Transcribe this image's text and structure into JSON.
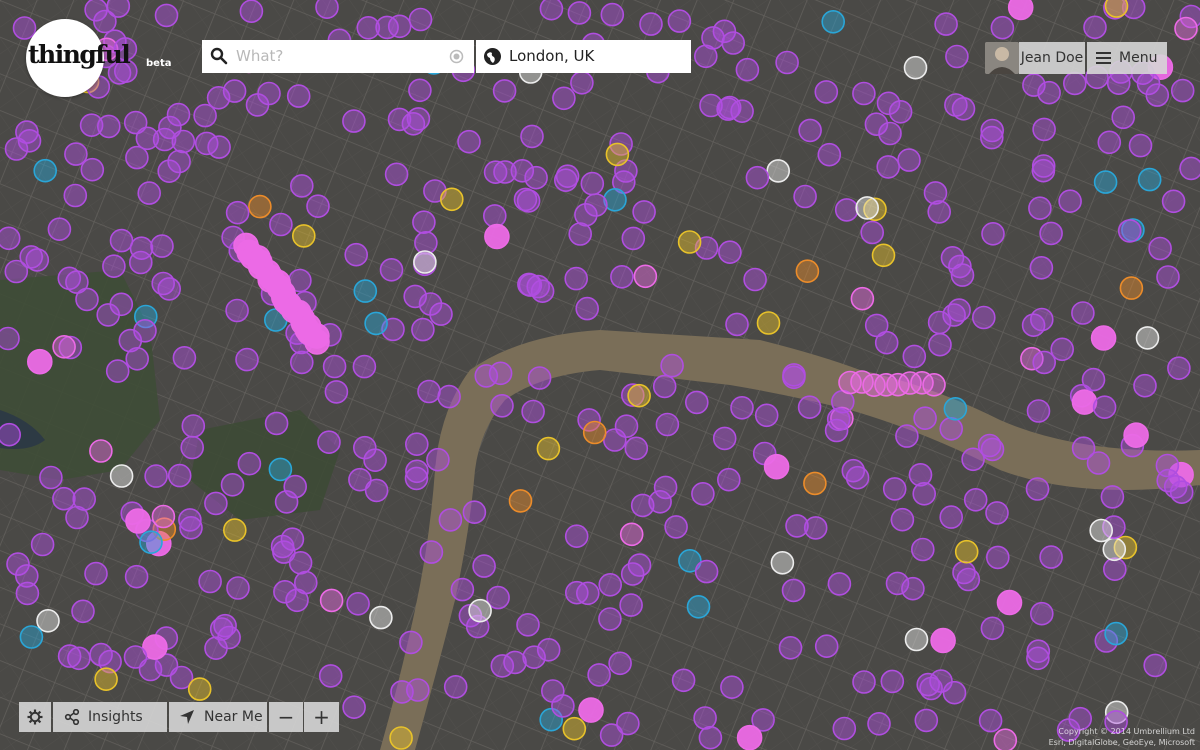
{
  "app": {
    "logo_text": "thingful",
    "logo_tag": "beta"
  },
  "search": {
    "placeholder": "What?",
    "value": "",
    "icon": "search-icon",
    "clear_icon": "clear-target-icon"
  },
  "location": {
    "value": "London, UK",
    "icon": "globe-icon"
  },
  "user": {
    "name": "Jean Doe",
    "avatar": "avatar"
  },
  "menu": {
    "label": "Menu",
    "icon": "hamburger-icon"
  },
  "toolbar": {
    "settings_icon": "gear-icon",
    "insights_label": "Insights",
    "insights_icon": "share-icon",
    "near_me_label": "Near Me",
    "near_me_icon": "location-arrow-icon",
    "zoom_out_label": "−",
    "zoom_in_label": "+"
  },
  "attribution": {
    "line1": "Copyright © 2014 Umbrellium Ltd",
    "line2": "Esri, DigitalGlobe, GeoEye, Microsoft"
  },
  "map": {
    "type": "satellite",
    "city": "London",
    "marker_colors": {
      "purple": "#b04ee0",
      "pink": "#ec6ae6",
      "cyan": "#2aa6d8",
      "yellow": "#e8c22a",
      "orange": "#ec8c2a",
      "white": "#ececec",
      "green": "#8ac23a"
    },
    "river_color": "#7a6e58"
  }
}
